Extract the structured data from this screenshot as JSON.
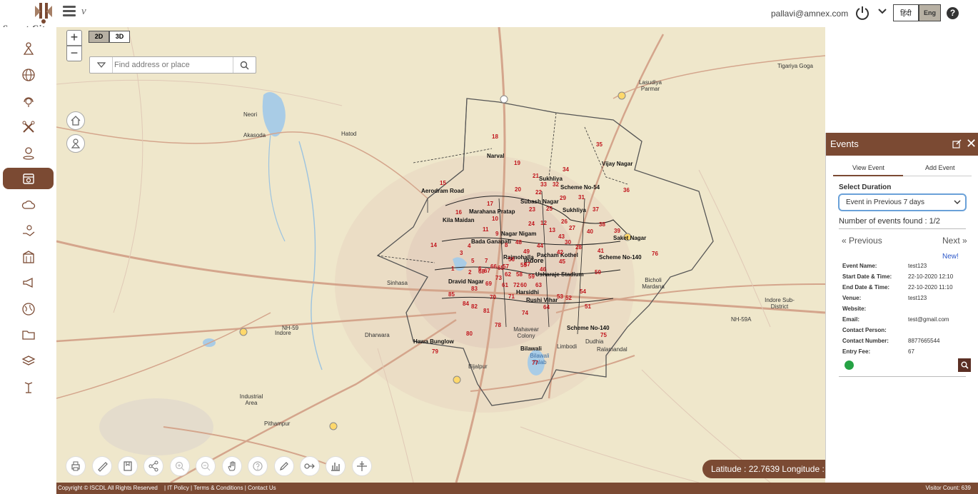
{
  "app": {
    "logo_text": "Smart City"
  },
  "header": {
    "user_email": "pallavi@amnex.com",
    "lang_hindi": "हिंदी",
    "lang_english": "Eng",
    "help_label": "?"
  },
  "sidebar": {
    "items": [
      {
        "name": "sidebar-item-tour",
        "icon": "tourist-icon"
      },
      {
        "name": "sidebar-item-global",
        "icon": "globe-icon"
      },
      {
        "name": "sidebar-item-support",
        "icon": "headset-icon"
      },
      {
        "name": "sidebar-item-tools",
        "icon": "tools-icon"
      },
      {
        "name": "sidebar-item-location",
        "icon": "location-person-icon"
      },
      {
        "name": "sidebar-item-events",
        "icon": "calendar-icon",
        "active": true
      },
      {
        "name": "sidebar-item-weather",
        "icon": "cloud-icon"
      },
      {
        "name": "sidebar-item-health",
        "icon": "hand-care-icon"
      },
      {
        "name": "sidebar-item-buildings",
        "icon": "building-icon"
      },
      {
        "name": "sidebar-item-announce",
        "icon": "megaphone-icon"
      },
      {
        "name": "sidebar-item-environment",
        "icon": "earth-icon"
      },
      {
        "name": "sidebar-item-folder",
        "icon": "folder-icon"
      },
      {
        "name": "sidebar-item-layers",
        "icon": "layers-icon"
      },
      {
        "name": "sidebar-item-streetlight",
        "icon": "streetlight-icon"
      }
    ]
  },
  "map": {
    "zoom_in": "+",
    "zoom_out": "−",
    "view_2d": "2D",
    "view_3d": "3D",
    "search_placeholder": "Find address or place",
    "coordinates_text": "Latitude : 22.7639 Longitude : 7",
    "places": [
      {
        "t": "Neori"
      },
      {
        "t": "Akasoda"
      },
      {
        "t": "Hatod"
      },
      {
        "t": "Lasudiya Parmar"
      },
      {
        "t": "Tigariya Goga"
      },
      {
        "t": "Sinhasa"
      },
      {
        "t": "Dharwara"
      },
      {
        "t": "Industrial Area"
      },
      {
        "t": "Pithampur"
      },
      {
        "t": "Bicholi Mardana"
      },
      {
        "t": "Indore Sub-District"
      },
      {
        "t": "NH-59A"
      },
      {
        "t": "NH-59"
      },
      {
        "t": "Bilawali Talab"
      },
      {
        "t": "Indore"
      }
    ],
    "ward_areas": [
      "Narval",
      "Vijay Nagar",
      "Sukhliya",
      "Scheme No-54",
      "Aerodram Road",
      "Marahana Pratap",
      "Subash Nagar",
      "Sukhliya",
      "Kila Maidan",
      "Nagar Nigam",
      "Saket Nagar",
      "Bada Ganapati",
      "Rajmohalla",
      "Pacham Kothel",
      "Scheme No-140",
      "Indore",
      "Usharaje Stadium",
      "Dravid Nagar",
      "Harsidhi",
      "Rushi Vihar",
      "Scheme No-140",
      "Mahavear Colony",
      "Hawa Bunglow",
      "Bilawali",
      "Limbodi",
      "Dudhia",
      "Ralamandal",
      "Bijalpur"
    ],
    "ward_numbers": [
      "18",
      "19",
      "15",
      "20",
      "21",
      "33",
      "34",
      "32",
      "35",
      "36",
      "17",
      "22",
      "23",
      "29",
      "31",
      "37",
      "16",
      "24",
      "14",
      "38",
      "39",
      "40",
      "41",
      "76",
      "75",
      "79",
      "80",
      "77",
      "50",
      "51",
      "52",
      "53",
      "54",
      "63",
      "64",
      "74",
      "78",
      "81",
      "82",
      "83",
      "84",
      "85",
      "1",
      "2",
      "3",
      "4",
      "5",
      "6",
      "7",
      "8",
      "9",
      "10",
      "11",
      "12",
      "13",
      "25",
      "26",
      "27",
      "28",
      "30",
      "42",
      "43",
      "44",
      "45",
      "46",
      "47",
      "48",
      "49",
      "55",
      "56",
      "57",
      "58",
      "59",
      "60",
      "61",
      "62",
      "65",
      "66",
      "67",
      "68",
      "69",
      "70",
      "71",
      "72",
      "73"
    ]
  },
  "tools": [
    {
      "name": "print-icon"
    },
    {
      "name": "ruler-icon"
    },
    {
      "name": "bookmark-icon"
    },
    {
      "name": "share-icon"
    },
    {
      "name": "zoom-in-tool-icon"
    },
    {
      "name": "zoom-out-tool-icon"
    },
    {
      "name": "pan-hand-icon"
    },
    {
      "name": "help-tool-icon"
    },
    {
      "name": "draw-icon"
    },
    {
      "name": "route-icon"
    },
    {
      "name": "chart-icon"
    },
    {
      "name": "crosshair-icon"
    }
  ],
  "events_panel": {
    "title": "Events",
    "tab_view": "View Event",
    "tab_add": "Add Event",
    "duration_label": "Select Duration",
    "duration_value": "Event in Previous 7 days",
    "found_text": "Number of events found : 1/2",
    "prev_label": "« Previous",
    "next_label": "Next »",
    "new_label": "New!",
    "details": [
      {
        "key": "Event Name:",
        "value": "test123"
      },
      {
        "key": "Start Date & Time:",
        "value": "22-10-2020 12:10"
      },
      {
        "key": "End Date & Time:",
        "value": "22-10-2020 11:10"
      },
      {
        "key": "Venue:",
        "value": "test123"
      },
      {
        "key": "Website:",
        "value": ""
      },
      {
        "key": "Email:",
        "value": "test@gmail.com"
      },
      {
        "key": "Contact Person:",
        "value": ""
      },
      {
        "key": "Contact Number:",
        "value": "8877665544"
      },
      {
        "key": "Entry Fee:",
        "value": "67"
      }
    ]
  },
  "footer": {
    "copyright": "Copyright © ISCDL All Rights Reserved",
    "links": "| IT Policy | Terms & Conditions | Contact Us",
    "visitor": "Visitor Count: 639"
  },
  "colors": {
    "brand": "#7b4a33",
    "ward_red": "#c0141c",
    "map_bg": "#efe7cb",
    "link_blue": "#2b57c9"
  }
}
